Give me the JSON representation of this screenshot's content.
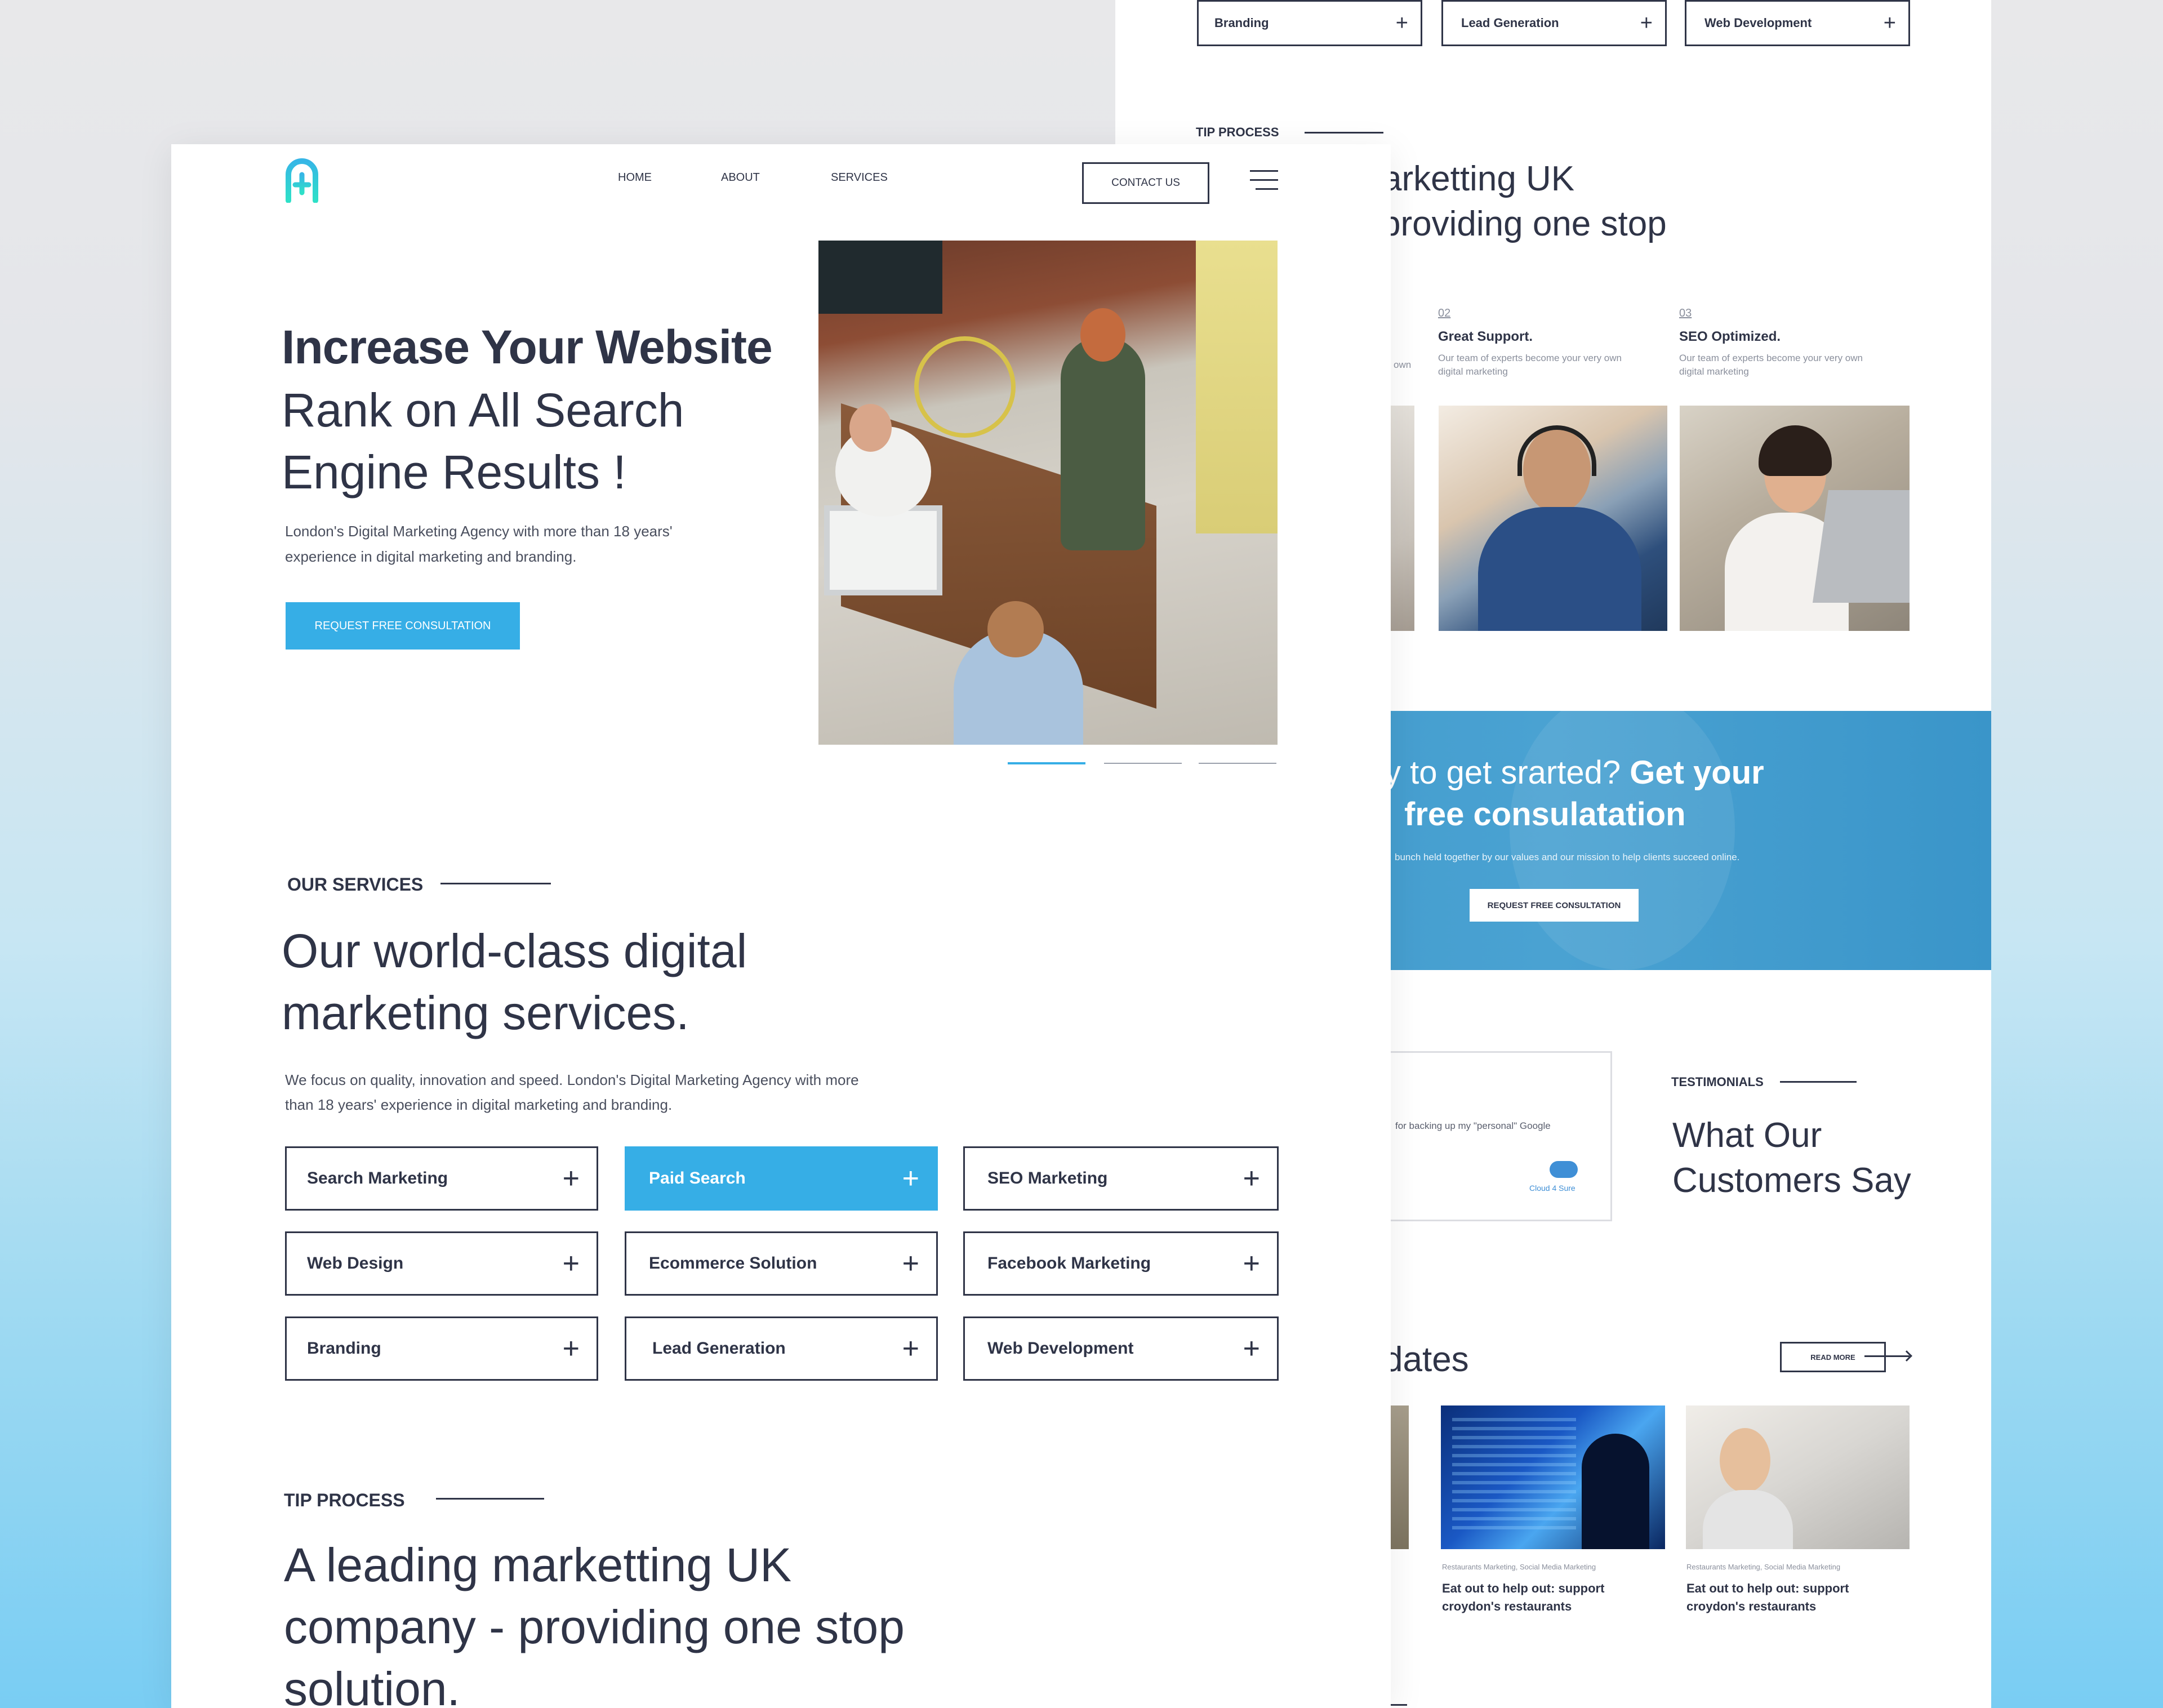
{
  "back": {
    "top_services": [
      "Branding",
      "Lead Generation",
      "Web Development"
    ],
    "tip": {
      "label": "TIP PROCESS",
      "line1": "arketting UK",
      "line2": "providing one stop"
    },
    "features": [
      {
        "partial": "own"
      },
      {
        "num": "02",
        "title": "Great Support.",
        "desc1": "Our team of experts become your very own",
        "desc2": "digital marketing"
      },
      {
        "num": "03",
        "title": "SEO Optimized.",
        "desc1": "Our team of experts become your very own",
        "desc2": "digital marketing"
      }
    ],
    "cta": {
      "light": "y to get srarted?",
      "bold1": "Get your",
      "bold2": "free consulatation",
      "sub": "bunch held together by our values and our mission to help clients succeed online.",
      "button": "REQUEST  FREE CONSULTATION"
    },
    "testimonial": {
      "quote": "for backing up my \"personal\" Google",
      "brand": "Cloud 4 Sure"
    },
    "testimonials": {
      "label": "TESTIMONIALS",
      "title1": "What Our",
      "title2": "Customers Say"
    },
    "updates": {
      "title_partial": "dates",
      "read_more": "READ MORE",
      "posts": [
        {
          "tags": "Restaurants Marketing, Social Media Marketing",
          "title1": "Eat out to help out: support",
          "title2": "croydon's restaurants"
        },
        {
          "tags": "Restaurants Marketing, Social Media Marketing",
          "title1": "Eat out to help out: support",
          "title2": "croydon's restaurants"
        }
      ]
    }
  },
  "front": {
    "nav": {
      "links": [
        "HOME",
        "ABOUT",
        "SERVICES"
      ],
      "contact": "CONTACT US"
    },
    "hero": {
      "title_bold": "Increase Your Website",
      "title_line2": "Rank on All Search",
      "title_line3": "Engine Results !",
      "sub1": "London's Digital Marketing Agency with more than 18 years'",
      "sub2": "experience in digital marketing and branding.",
      "cta": "REQUEST  FREE CONSULTATION",
      "slider_active": 0,
      "slider_count": 3
    },
    "services": {
      "label": "OUR SERVICES",
      "title1": "Our world-class digital",
      "title2": "marketing services.",
      "desc1": "We focus on quality, innovation and speed. London's Digital Marketing Agency with more",
      "desc2": "than 18 years' experience in digital marketing and branding.",
      "items": [
        "Search Marketing",
        "Paid Search",
        "SEO Marketing",
        "Web Design",
        "Ecommerce Solution",
        "Facebook Marketing",
        "Branding",
        "Lead Generation",
        "Web Development"
      ],
      "active_index": 1
    },
    "tip": {
      "label": "TIP PROCESS",
      "line1": "A leading marketting UK",
      "line2": "company - providing one stop",
      "line3": "solution."
    }
  },
  "colors": {
    "accent": "#36aee6",
    "dark": "#2f3447",
    "cta_band": "#4a9fcf"
  }
}
